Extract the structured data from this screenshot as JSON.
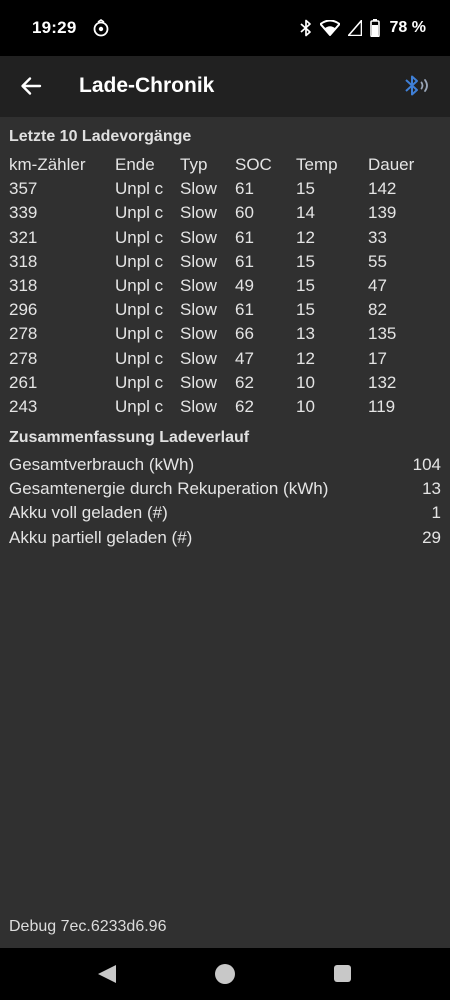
{
  "status_bar": {
    "time": "19:29",
    "battery_text": "78 %",
    "icons": [
      "notification-icon",
      "bluetooth-status-icon",
      "wifi-icon",
      "signal-icon",
      "battery-icon"
    ]
  },
  "app_bar": {
    "title": "Lade-Chronik",
    "back_icon": "arrow-left-icon",
    "action_icon": "bluetooth-connected-icon",
    "accent_color": "#3f7fd6"
  },
  "history": {
    "title": "Letzte 10 Ladevorgänge",
    "columns": [
      "km-Zähler",
      "Ende",
      "Typ",
      "SOC",
      "Temp",
      "Dauer"
    ],
    "rows": [
      [
        "357",
        "Unpl c",
        "Slow",
        "61",
        "15",
        "142"
      ],
      [
        "339",
        "Unpl c",
        "Slow",
        "60",
        "14",
        "139"
      ],
      [
        "321",
        "Unpl c",
        "Slow",
        "61",
        "12",
        "33"
      ],
      [
        "318",
        "Unpl c",
        "Slow",
        "61",
        "15",
        "55"
      ],
      [
        "318",
        "Unpl c",
        "Slow",
        "49",
        "15",
        "47"
      ],
      [
        "296",
        "Unpl c",
        "Slow",
        "61",
        "15",
        "82"
      ],
      [
        "278",
        "Unpl c",
        "Slow",
        "66",
        "13",
        "135"
      ],
      [
        "278",
        "Unpl c",
        "Slow",
        "47",
        "12",
        "17"
      ],
      [
        "261",
        "Unpl c",
        "Slow",
        "62",
        "10",
        "132"
      ],
      [
        "243",
        "Unpl c",
        "Slow",
        "62",
        "10",
        "119"
      ]
    ]
  },
  "summary": {
    "title": "Zusammenfassung Ladeverlauf",
    "items": [
      {
        "label": "Gesamtverbrauch (kWh)",
        "value": "104"
      },
      {
        "label": "Gesamtenergie durch Rekuperation (kWh)",
        "value": "13"
      },
      {
        "label": "Akku voll geladen (#)",
        "value": "1"
      },
      {
        "label": "Akku partiell geladen (#)",
        "value": "29"
      }
    ]
  },
  "debug": "Debug 7ec.6233d6.96",
  "nav_bar": {
    "icons": [
      "nav-back-icon",
      "nav-home-icon",
      "nav-recents-icon"
    ]
  }
}
